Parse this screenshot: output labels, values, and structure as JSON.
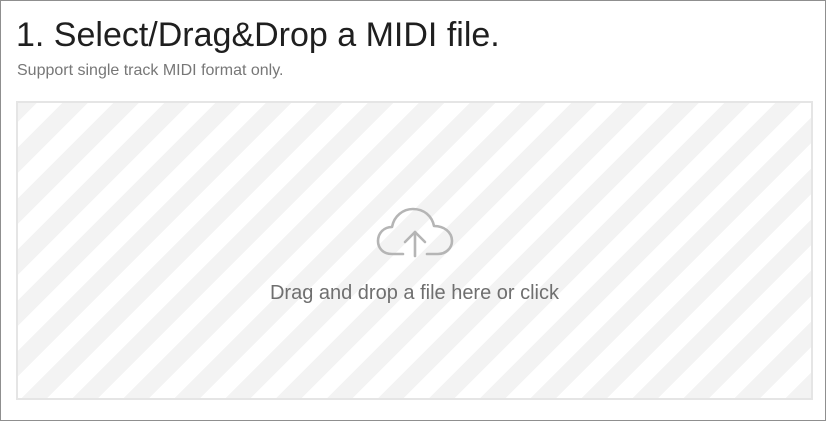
{
  "header": {
    "title": "1. Select/Drag&Drop a MIDI file.",
    "subtitle": "Support single track MIDI format only."
  },
  "dropzone": {
    "icon": "cloud-upload-icon",
    "label": "Drag and drop a file here or click"
  },
  "colors": {
    "title": "#1f1f1f",
    "subtitle": "#777777",
    "dropzone_border": "#e5e5e5",
    "stripe": "#f3f3f3",
    "icon": "#b5b5b5",
    "dropzone_text": "#6f6f6f"
  }
}
